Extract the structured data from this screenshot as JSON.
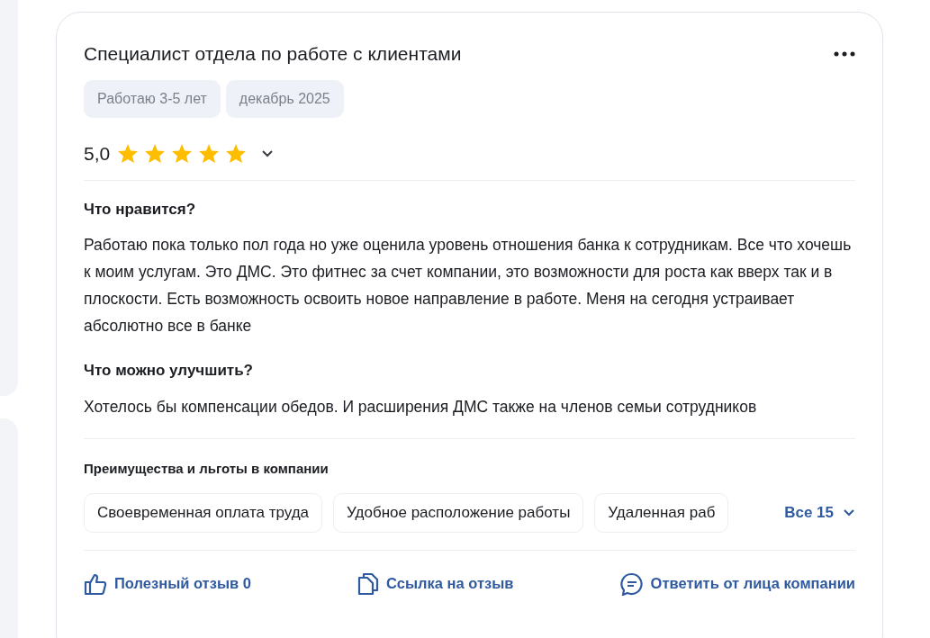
{
  "review": {
    "title": "Специалист отдела по работе с клиентами",
    "tags": [
      "Работаю 3-5 лет",
      "декабрь 2025"
    ],
    "rating": "5,0",
    "stars": 5,
    "sections": [
      {
        "heading": "Что нравится?",
        "text": "Работаю пока только пол года но уже оценила уровень отношения банка к сотрудникам. Все что хочешь к моим услугам. Это ДМС. Это фитнес за счет компании, это возможности для роста как вверх так и в плоскости. Есть возможность освоить новое направление в работе. Меня на сегодня устраивает абсолютно все в банке"
      },
      {
        "heading": "Что можно улучшить?",
        "text": "Хотелось бы компенсации обедов. И расширения ДМС также на членов семьи сотрудников"
      }
    ],
    "benefits": {
      "title": "Преимущества и льготы в компании",
      "items": [
        "Своевременная оплата труда",
        "Удобное расположение работы",
        "Удаленная раб"
      ],
      "more": "Все 15"
    },
    "actions": [
      {
        "kind": "like",
        "label": "Полезный отзыв 0"
      },
      {
        "kind": "link",
        "label": "Ссылка на отзыв"
      },
      {
        "kind": "reply",
        "label": "Ответить от лица компании"
      }
    ]
  }
}
